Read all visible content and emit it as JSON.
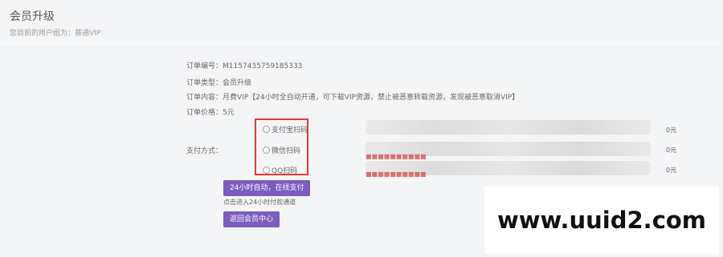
{
  "header": {
    "title": "会员升级",
    "subtitle": "您目前的用户组为：普通VIP"
  },
  "order": {
    "number_label": "订单编号：",
    "number_value": "M1157435759185333",
    "type_label": "订单类型：",
    "type_value": "会员升级",
    "content_label": "订单内容：",
    "content_value": "月费VIP【24小时全自动开通，可下载VIP资源，禁止被恶意转载资源，发现被恶意取消VIP】",
    "price_label": "订单价格：",
    "price_value": "5元"
  },
  "payment": {
    "label": "支付方式：",
    "options": [
      {
        "label": "支付宝扫码"
      },
      {
        "label": "微信扫码"
      },
      {
        "label": "QQ扫码"
      }
    ],
    "prices": [
      "0元",
      "0元",
      "0元"
    ]
  },
  "buttons": {
    "pay": "24小时自动，在线支付",
    "back": "返回会员中心"
  },
  "note": "点击进入24小时付款通道",
  "watermark": "www.uuid2.com",
  "colors": {
    "accent": "#7c5cbf",
    "highlight_box": "#e53935"
  }
}
